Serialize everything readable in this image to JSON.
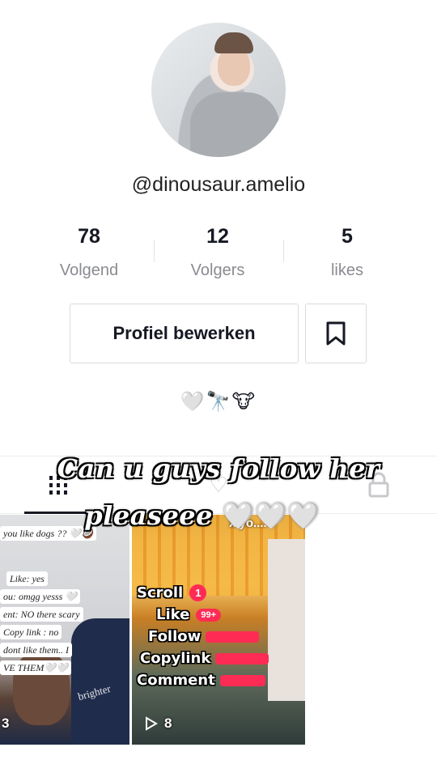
{
  "profile": {
    "username": "@dinousaur.amelio",
    "bio_emoji": "🤍🔭🐮"
  },
  "stats": [
    {
      "value": "78",
      "label": "Volgend"
    },
    {
      "value": "12",
      "label": "Volgers"
    },
    {
      "value": "5",
      "label": "likes"
    }
  ],
  "actions": {
    "edit_profile_label": "Profiel bewerken"
  },
  "tabs": {
    "grid": "grid-icon",
    "liked": "heart-icon",
    "private": "lock-icon"
  },
  "overlay": {
    "line1": "Can u guys follow her",
    "line2": "pleaseee",
    "line2_hearts": "🤍🤍🤍",
    "hidden_fragment": "x yo...."
  },
  "videos": [
    {
      "caption_lines": [
        "you like dogs ?? 🤍🥥",
        "Like: yes",
        "ou: omgg yesss 🤍",
        "ent: NO there scary",
        "Copy link : no",
        "dont like them.. I",
        "VE THEM🤍🤍"
      ],
      "hoodie_text": "brighter",
      "play_count": "3"
    },
    {
      "rows": [
        {
          "word": "Scroll",
          "badge": "1"
        },
        {
          "word": "Like",
          "badge": "99+"
        },
        {
          "word": "Follow",
          "badge": ""
        },
        {
          "word": "Copylink",
          "badge": ""
        },
        {
          "word": "Comment",
          "badge": ""
        }
      ],
      "play_count": "8"
    }
  ],
  "colors": {
    "accent": "#fe2c55",
    "text": "#161823",
    "muted": "#8a8b91"
  }
}
